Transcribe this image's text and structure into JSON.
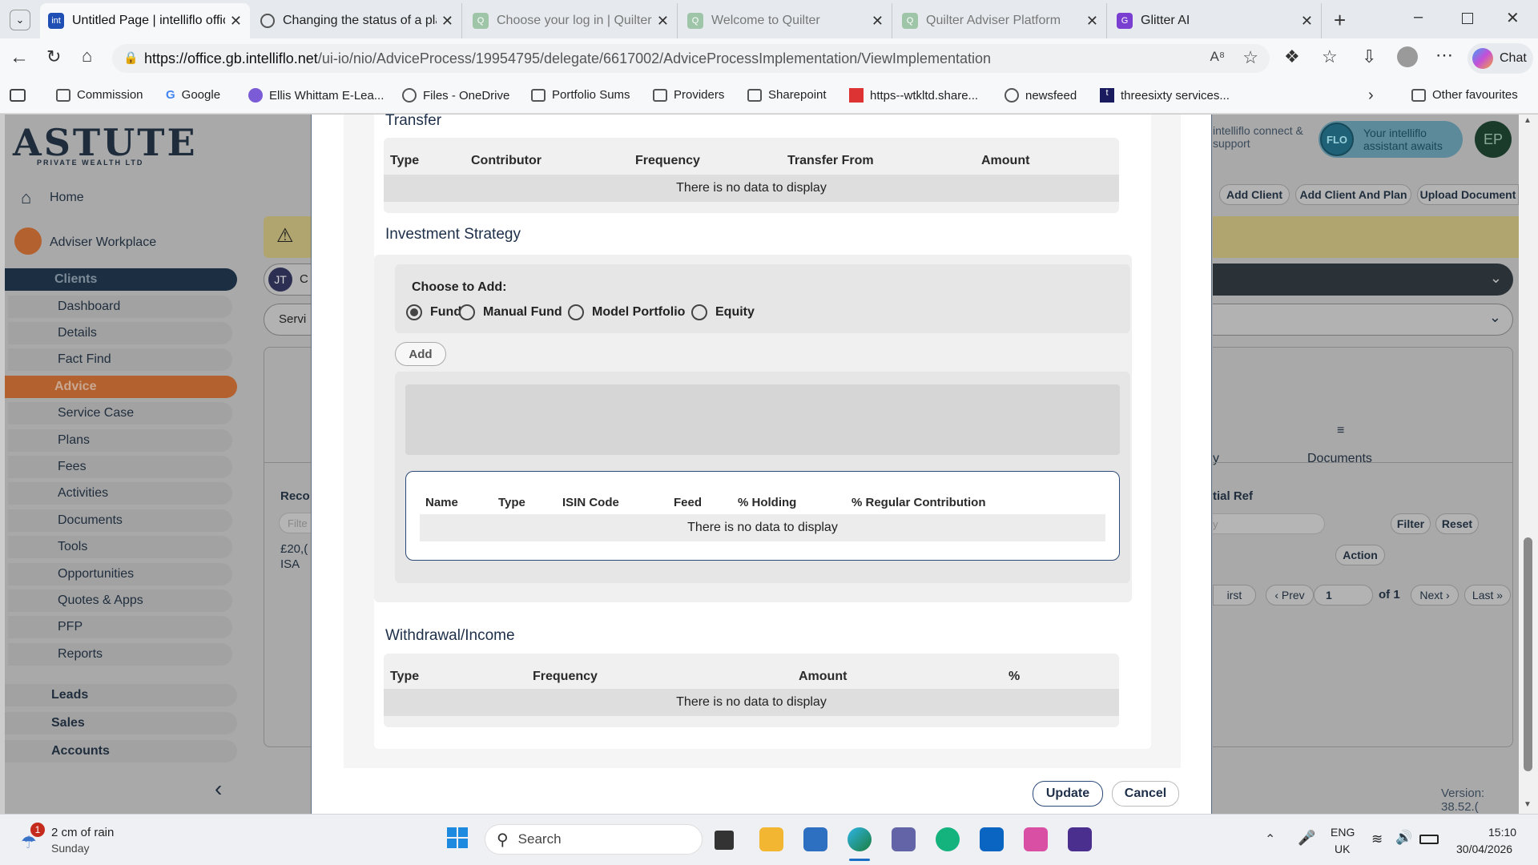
{
  "browser": {
    "tabs": [
      {
        "title": "Untitled Page | intelliflo office",
        "active": true
      },
      {
        "title": "Changing the status of a plan"
      },
      {
        "title": "Choose your log in | Quilter"
      },
      {
        "title": "Welcome to Quilter"
      },
      {
        "title": "Quilter Adviser Platform"
      },
      {
        "title": "Glitter AI"
      }
    ],
    "url_host": "https://office.gb.intelliflo.net",
    "url_path": "/ui-io/nio/AdviceProcess/19954795/delegate/6617002/AdviceProcessImplementation/ViewImplementation",
    "chat_label": "Chat",
    "bookmarks": [
      "Commission",
      "Google",
      "Ellis Whittam E-Lea...",
      "Files - OneDrive",
      "Portfolio Sums",
      "Providers",
      "Sharepoint",
      "https--wtkltd.share...",
      "newsfeed",
      "threesixty services..."
    ],
    "other_favourites": "Other favourites"
  },
  "sidebar": {
    "logo": "ASTUTE",
    "logo_sub": "PRIVATE WEALTH LTD",
    "home": "Home",
    "workplace": "Adviser Workplace",
    "items": [
      "Clients",
      "Dashboard",
      "Details",
      "Fact Find",
      "Advice",
      "Service Case",
      "Plans",
      "Fees",
      "Activities",
      "Documents",
      "Tools",
      "Opportunities",
      "Quotes & Apps",
      "PFP",
      "Reports"
    ],
    "lower_items": [
      "Leads",
      "Sales",
      "Accounts"
    ]
  },
  "background_page": {
    "connect": "intelliflo connect & support",
    "flo": "Your intelliflo assistant awaits",
    "avatar": "EP",
    "client_initials": "JT",
    "client_partial": "C",
    "service_partial": "Servi",
    "buttons": [
      "Add Client",
      "Add Client And Plan",
      "Upload Document"
    ],
    "documents_tab": "Documents",
    "partial_y": "y",
    "partial_rec": "Reco",
    "partial_filter": "Filte",
    "partial_amount": "£20,(",
    "partial_isa": "ISA",
    "partial_ref": "tial Ref",
    "filter_btn": "Filter",
    "reset_btn": "Reset",
    "action_btn": "Action",
    "pager": {
      "first": "irst",
      "prev": "‹ Prev",
      "page": "1",
      "of": "of 1",
      "next": "Next ›",
      "last": "Last »"
    },
    "version": "Version: 38.52.("
  },
  "modal": {
    "transfer": {
      "heading": "Transfer",
      "columns": [
        "Type",
        "Contributor",
        "Frequency",
        "Transfer From",
        "Amount"
      ],
      "empty": "There is no data to display"
    },
    "investment": {
      "heading": "Investment Strategy",
      "choose_label": "Choose to Add:",
      "options": [
        "Fund",
        "Manual Fund",
        "Model Portfolio",
        "Equity"
      ],
      "selected": "Fund",
      "add_button": "Add",
      "columns": [
        "Name",
        "Type",
        "ISIN Code",
        "Feed",
        "% Holding",
        "% Regular Contribution"
      ],
      "empty": "There is no data to display"
    },
    "withdrawal": {
      "heading": "Withdrawal/Income",
      "columns": [
        "Type",
        "Frequency",
        "Amount",
        "%"
      ],
      "empty": "There is no data to display"
    },
    "update_button": "Update",
    "cancel_button": "Cancel"
  },
  "taskbar": {
    "weather_badge": "1",
    "weather": "2 cm of rain",
    "weather_day": "Sunday",
    "search": "Search",
    "lang": "ENG",
    "region": "UK",
    "time": "15:10",
    "date": "30/04/2026"
  },
  "colors": {
    "dark_navy": "#1c2f42",
    "advice_orange": "#b3612f",
    "heading_blue": "#1e2f4a"
  }
}
